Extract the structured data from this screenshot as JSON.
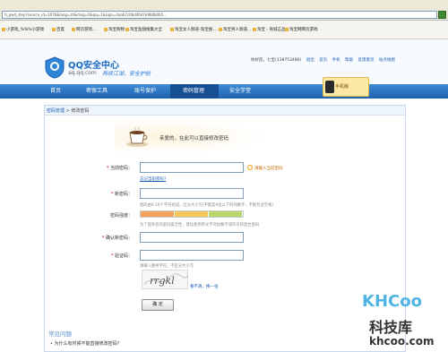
{
  "browser": {
    "url": "ti_pwd_step?source_id=1076&lang=zh&msg=0&qq=1&sign=4aab7c0bd46d7e9b8b0b5...",
    "bookmarks": [
      {
        "label": "小游戏_%%%小游戏"
      },
      {
        "label": "百度"
      },
      {
        "label": "网页游戏..."
      },
      {
        "label": "淘宝购物"
      },
      {
        "label": "淘宝鱼翅搜集大全"
      },
      {
        "label": "淘宝女人频道-淘宝搜...."
      },
      {
        "label": "淘宝男人频道..."
      },
      {
        "label": "淘宝 - 商城正品"
      },
      {
        "label": "淘宝网网页游戏"
      }
    ]
  },
  "header": {
    "site_title": "QQ安全中心",
    "site_url": "aq.qq.com",
    "slogan": "再续江湖，安全护航",
    "user_greeting": "你好您，七宝(138753486)",
    "links": [
      "退出",
      "首页",
      "手机",
      "帮助",
      "反馈意见",
      "站点地图"
    ],
    "badge_label": "手机版"
  },
  "nav": {
    "items": [
      "首页",
      "密保工具",
      "账号保护",
      "密码管理",
      "安全学堂"
    ],
    "active_index": 3
  },
  "breadcrumb": {
    "parent": "密码管理",
    "separator": ">",
    "current": "修改密码"
  },
  "form": {
    "welcome": "亲爱的，在此可以直接修改密码",
    "current_password_label": "当前密码：",
    "current_password_hint": "请输入当前密码",
    "forgot_link": "忘记当前密码?",
    "new_password_label": "新密码：",
    "new_password_hint": "密码由6-16个字符组成，区分大小写(不能是9位以下的纯数字，不能包含空格)",
    "strength_label": "密码强度：",
    "strength_colors": [
      "#f3a35b",
      "#f6c75b",
      "#b8d86b"
    ],
    "strength_hint": "为了提升您的密码安全性，建议使用英文字母加数字或符号的混合密码",
    "confirm_label": "确认新密码：",
    "captcha_label": "验证码：",
    "captcha_hint": "请输入图中字符，不区分大小写",
    "captcha_text": "rrgkl",
    "captcha_refresh": "看不清，换一张",
    "submit_label": "确 定"
  },
  "faq": {
    "title": "常见问题",
    "items": [
      "为什么有时候不能直接修改密码?"
    ]
  },
  "watermark": {
    "logo_text": "KHCoo",
    "cn_text": "科技库",
    "url_text": "khcoo.com"
  }
}
